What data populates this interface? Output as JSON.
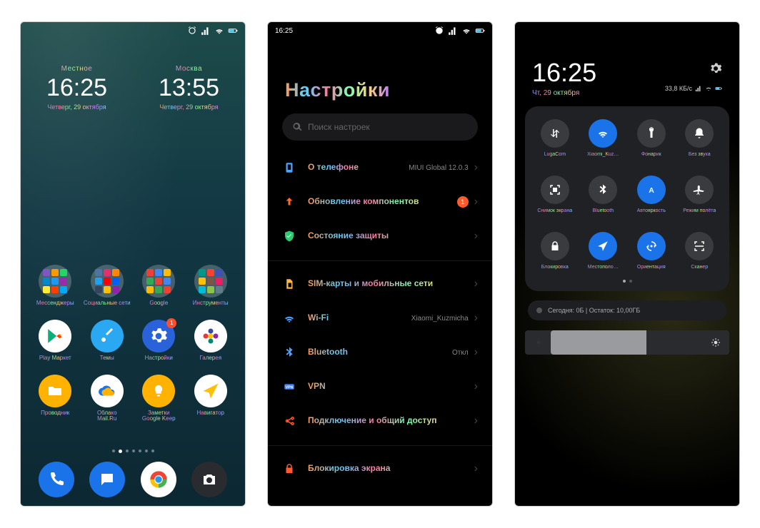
{
  "status": {
    "time": "16:25"
  },
  "home": {
    "clocks": [
      {
        "label": "Местное",
        "time": "16:25",
        "date": "Четверг, 29 октября"
      },
      {
        "label": "Москва",
        "time": "13:55",
        "date": "Четверг, 29 октября"
      }
    ],
    "folders": [
      {
        "name": "Мессенджеры"
      },
      {
        "name": "Социальные сети"
      },
      {
        "name": "Google"
      },
      {
        "name": "Инструменты"
      }
    ],
    "apps_row2": [
      {
        "name": "Play Маркет",
        "bg": "#fff",
        "icon": "play"
      },
      {
        "name": "Темы",
        "bg": "#2aa8f2",
        "icon": "brush"
      },
      {
        "name": "Настройки",
        "bg": "#2962d9",
        "icon": "gear",
        "badge": "1"
      },
      {
        "name": "Галерея",
        "bg": "#fff",
        "icon": "flower"
      }
    ],
    "apps_row3": [
      {
        "name": "Проводник",
        "bg": "#ffb300",
        "icon": "folder"
      },
      {
        "name": "Облако\nMail.Ru",
        "bg": "#ffffff",
        "icon": "cloud"
      },
      {
        "name": "Заметки\nGoogle Keep",
        "bg": "#ffb300",
        "icon": "bulb"
      },
      {
        "name": "Навигатор",
        "bg": "#ffffff",
        "icon": "nav"
      }
    ],
    "dock": [
      {
        "name": "Телефон",
        "bg": "#1a73e8",
        "icon": "phone"
      },
      {
        "name": "Сообщения",
        "bg": "#1a73e8",
        "icon": "msg"
      },
      {
        "name": "Chrome",
        "bg": "#fff",
        "icon": "chrome"
      },
      {
        "name": "Камера",
        "bg": "#2a2b2e",
        "icon": "camera"
      }
    ]
  },
  "settings": {
    "title": "Настройки",
    "search_placeholder": "Поиск настроек",
    "items": [
      {
        "icon": "phone-info",
        "color": "#4aa3ff",
        "label": "О телефоне",
        "value": "MIUI Global 12.0.3"
      },
      {
        "icon": "arrow-up",
        "color": "#ff6a2e",
        "label": "Обновление компонентов",
        "badge": "1"
      },
      {
        "icon": "shield",
        "color": "#2ecc71",
        "label": "Состояние защиты"
      },
      {
        "sep": true,
        "icon": "sim",
        "color": "#ffb648",
        "label": "SIM-карты и мобильные сети"
      },
      {
        "icon": "wifi",
        "color": "#4aa3ff",
        "label": "Wi-Fi",
        "value": "Xiaomi_Kuzmicha"
      },
      {
        "icon": "bt",
        "color": "#4aa3ff",
        "label": "Bluetooth",
        "value": "Откл"
      },
      {
        "icon": "vpn",
        "color": "#3b82f6",
        "label": "VPN"
      },
      {
        "icon": "share",
        "color": "#ff5a2e",
        "label": "Подключение и общий доступ"
      },
      {
        "sep": true,
        "icon": "lock",
        "color": "#ff5a2e",
        "label": "Блокировка экрана"
      }
    ]
  },
  "quick": {
    "time": "16:25",
    "date": "Чт, 29 октября",
    "net": "33,8 КБ/с",
    "tiles": [
      {
        "icon": "data",
        "label": "LugaCom",
        "on": false
      },
      {
        "icon": "wifi",
        "label": "Xiaomi_Kuz…",
        "on": true
      },
      {
        "icon": "torch",
        "label": "Фонарик",
        "on": false
      },
      {
        "icon": "bell",
        "label": "Без звука",
        "on": false
      },
      {
        "icon": "screenshot",
        "label": "Снимок экрана",
        "on": false
      },
      {
        "icon": "bt",
        "label": "Bluetooth",
        "on": false
      },
      {
        "icon": "auto-bright",
        "label": "Автояркость",
        "on": true
      },
      {
        "icon": "plane",
        "label": "Режим полёта",
        "on": false
      },
      {
        "icon": "lock",
        "label": "Блокировка",
        "on": false
      },
      {
        "icon": "location",
        "label": "Местополо…",
        "on": true
      },
      {
        "icon": "rotate",
        "label": "Ориентация",
        "on": true
      },
      {
        "icon": "scan",
        "label": "Сканер",
        "on": false
      }
    ],
    "data_line": "Сегодня: 0Б   |   Остаток: 10,00ГБ",
    "brightness": 60
  }
}
